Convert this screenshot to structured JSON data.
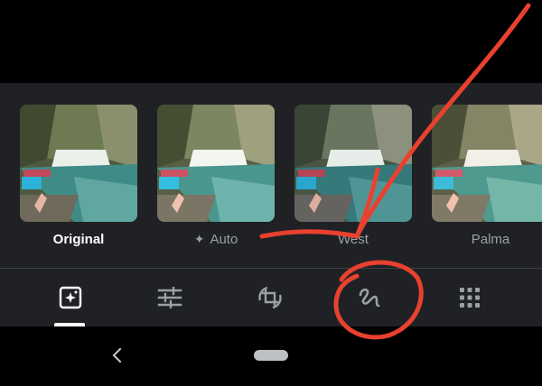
{
  "filters": [
    {
      "label": "Original",
      "active": true,
      "sparkle": false
    },
    {
      "label": "Auto",
      "active": false,
      "sparkle": true
    },
    {
      "label": "West",
      "active": false,
      "sparkle": false
    },
    {
      "label": "Palma",
      "active": false,
      "sparkle": false
    }
  ],
  "toolbar": {
    "tools": [
      "filters-icon",
      "adjust-icon",
      "crop-rotate-icon",
      "markup-icon",
      "more-tools-icon"
    ],
    "active_tool": "filters-icon"
  },
  "annotation_color": "#e8412f",
  "colors": {
    "panel": "#202124",
    "active_label": "#ffffff",
    "inactive_label": "#9aa0a6"
  }
}
